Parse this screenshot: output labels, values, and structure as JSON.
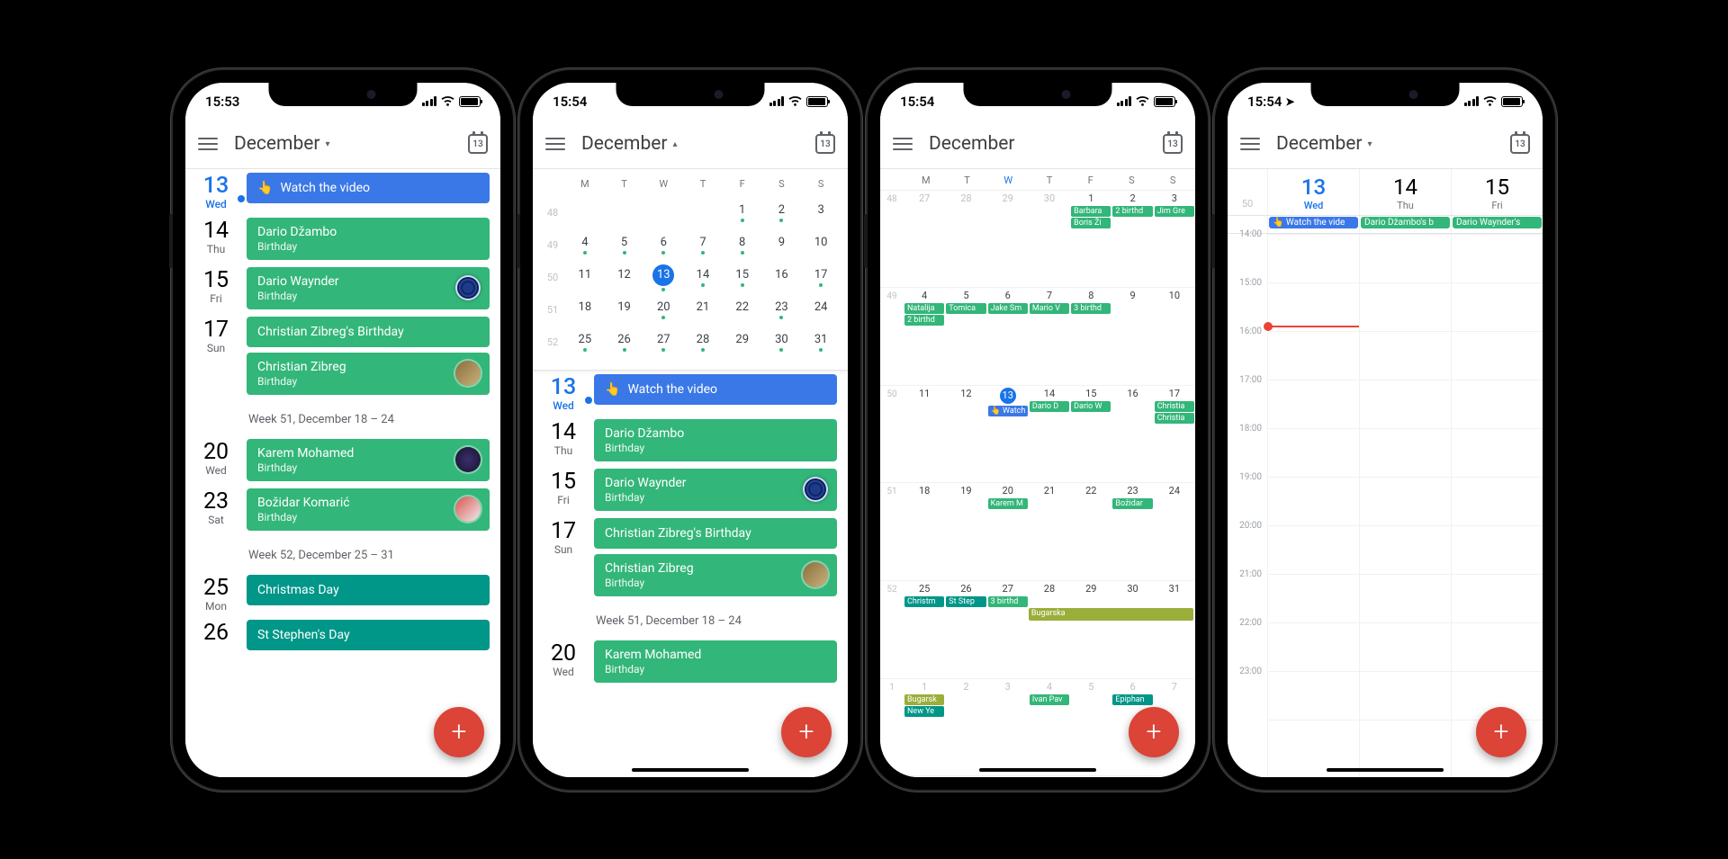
{
  "colors": {
    "blue": "#3b78e7",
    "green": "#33b679",
    "teal": "#009688",
    "olive": "#9aae3a",
    "red": "#db4437"
  },
  "common": {
    "month": "December",
    "today_date": "13",
    "watch_video": "Watch the video",
    "birthday_label": "Birthday"
  },
  "phone1": {
    "time": "15:53",
    "caret": "▾",
    "days": [
      {
        "date": "13",
        "dow": "Wed",
        "today": true,
        "events": [
          {
            "title": "Watch the video",
            "color": "blue",
            "icon": "👆"
          }
        ]
      },
      {
        "date": "14",
        "dow": "Thu",
        "events": [
          {
            "title": "Dario Džambo",
            "sub": "Birthday",
            "color": "green"
          }
        ]
      },
      {
        "date": "15",
        "dow": "Fri",
        "events": [
          {
            "title": "Dario Waynder",
            "sub": "Birthday",
            "color": "green",
            "avatar": "ring"
          }
        ]
      },
      {
        "date": "17",
        "dow": "Sun",
        "events": [
          {
            "title": "Christian Zibreg's Birthday",
            "color": "green"
          },
          {
            "title": "Christian Zibreg",
            "sub": "Birthday",
            "color": "green",
            "avatar": "p1"
          }
        ]
      }
    ],
    "week51_label": "Week 51, December 18 – 24",
    "days2": [
      {
        "date": "20",
        "dow": "Wed",
        "events": [
          {
            "title": "Karem Mohamed",
            "sub": "Birthday",
            "color": "green",
            "avatar": "p2"
          }
        ]
      },
      {
        "date": "23",
        "dow": "Sat",
        "events": [
          {
            "title": "Božidar Komarić",
            "sub": "Birthday",
            "color": "green",
            "avatar": "p3"
          }
        ]
      }
    ],
    "week52_label": "Week 52, December 25 – 31",
    "days3": [
      {
        "date": "25",
        "dow": "Mon",
        "events": [
          {
            "title": "Christmas Day",
            "color": "teal"
          }
        ]
      },
      {
        "date": "26",
        "dow": "",
        "events": [
          {
            "title": "St Stephen's Day",
            "color": "teal"
          }
        ]
      }
    ]
  },
  "phone2": {
    "time": "15:54",
    "caret": "▴",
    "dow_labels": [
      "M",
      "T",
      "W",
      "T",
      "F",
      "S",
      "S"
    ],
    "weeks": [
      {
        "wk": "48",
        "days": [
          {
            "n": ""
          },
          {
            "n": ""
          },
          {
            "n": ""
          },
          {
            "n": ""
          },
          {
            "n": "1",
            "dot": true
          },
          {
            "n": "2",
            "dot": true
          },
          {
            "n": "3"
          }
        ]
      },
      {
        "wk": "49",
        "days": [
          {
            "n": "4",
            "dot": true
          },
          {
            "n": "5",
            "dot": true
          },
          {
            "n": "6",
            "dot": true
          },
          {
            "n": "7",
            "dot": true
          },
          {
            "n": "8",
            "dot": true
          },
          {
            "n": "9"
          },
          {
            "n": "10"
          }
        ]
      },
      {
        "wk": "50",
        "days": [
          {
            "n": "11"
          },
          {
            "n": "12"
          },
          {
            "n": "13",
            "today": true,
            "dot": true
          },
          {
            "n": "14",
            "dot": true
          },
          {
            "n": "15",
            "dot": true
          },
          {
            "n": "16"
          },
          {
            "n": "17",
            "dot": true
          }
        ]
      },
      {
        "wk": "51",
        "days": [
          {
            "n": "18"
          },
          {
            "n": "19"
          },
          {
            "n": "20",
            "dot": true
          },
          {
            "n": "21"
          },
          {
            "n": "22"
          },
          {
            "n": "23",
            "dot": true
          },
          {
            "n": "24"
          }
        ]
      },
      {
        "wk": "52",
        "days": [
          {
            "n": "25",
            "dot": true
          },
          {
            "n": "26",
            "dot": true
          },
          {
            "n": "27",
            "dot": true
          },
          {
            "n": "28",
            "dot": true
          },
          {
            "n": "29"
          },
          {
            "n": "30",
            "dot": true
          },
          {
            "n": "31",
            "dot": true
          }
        ]
      }
    ],
    "days": [
      {
        "date": "13",
        "dow": "Wed",
        "today": true,
        "events": [
          {
            "title": "Watch the video",
            "color": "blue",
            "icon": "👆"
          }
        ]
      },
      {
        "date": "14",
        "dow": "Thu",
        "events": [
          {
            "title": "Dario Džambo",
            "sub": "Birthday",
            "color": "green"
          }
        ]
      },
      {
        "date": "15",
        "dow": "Fri",
        "events": [
          {
            "title": "Dario Waynder",
            "sub": "Birthday",
            "color": "green",
            "avatar": "ring"
          }
        ]
      },
      {
        "date": "17",
        "dow": "Sun",
        "events": [
          {
            "title": "Christian Zibreg's Birthday",
            "color": "green"
          },
          {
            "title": "Christian Zibreg",
            "sub": "Birthday",
            "color": "green",
            "avatar": "p1"
          }
        ]
      }
    ],
    "week51_label": "Week 51, December 18 – 24",
    "days2": [
      {
        "date": "20",
        "dow": "Wed",
        "events": [
          {
            "title": "Karem Mohamed",
            "sub": "Birthday",
            "color": "green"
          }
        ]
      }
    ]
  },
  "phone3": {
    "time": "15:54",
    "dow_labels": [
      "M",
      "T",
      "W",
      "T",
      "F",
      "S",
      "S"
    ],
    "rows": [
      {
        "wk": "48",
        "cells": [
          {
            "n": "27",
            "out": true,
            "chips": []
          },
          {
            "n": "28",
            "out": true,
            "chips": []
          },
          {
            "n": "29",
            "out": true,
            "chips": []
          },
          {
            "n": "30",
            "out": true,
            "chips": []
          },
          {
            "n": "1",
            "chips": [
              {
                "t": "Barbara",
                "c": "green"
              },
              {
                "t": "Boris Ži",
                "c": "green"
              }
            ]
          },
          {
            "n": "2",
            "chips": [
              {
                "t": "2 birthd",
                "c": "green"
              }
            ]
          },
          {
            "n": "3",
            "chips": [
              {
                "t": "Jim Gre",
                "c": "green"
              }
            ]
          }
        ]
      },
      {
        "wk": "49",
        "cells": [
          {
            "n": "4",
            "chips": [
              {
                "t": "Natalija",
                "c": "green"
              },
              {
                "t": "2 birthd",
                "c": "green"
              }
            ]
          },
          {
            "n": "5",
            "chips": [
              {
                "t": "Tomica",
                "c": "green"
              }
            ]
          },
          {
            "n": "6",
            "chips": [
              {
                "t": "Jake Sm",
                "c": "green"
              }
            ]
          },
          {
            "n": "7",
            "chips": [
              {
                "t": "Mario V",
                "c": "green"
              }
            ]
          },
          {
            "n": "8",
            "chips": [
              {
                "t": "3 birthd",
                "c": "green"
              }
            ]
          },
          {
            "n": "9",
            "chips": []
          },
          {
            "n": "10",
            "chips": []
          }
        ]
      },
      {
        "wk": "50",
        "cells": [
          {
            "n": "11",
            "chips": []
          },
          {
            "n": "12",
            "chips": []
          },
          {
            "n": "13",
            "today": true,
            "chips": [
              {
                "t": "👆 Watch",
                "c": "blue"
              }
            ]
          },
          {
            "n": "14",
            "chips": [
              {
                "t": "Dario D",
                "c": "green"
              }
            ]
          },
          {
            "n": "15",
            "chips": [
              {
                "t": "Dario W",
                "c": "green"
              }
            ]
          },
          {
            "n": "16",
            "chips": []
          },
          {
            "n": "17",
            "chips": [
              {
                "t": "Christia",
                "c": "green"
              },
              {
                "t": "Christia",
                "c": "green"
              }
            ]
          }
        ]
      },
      {
        "wk": "51",
        "cells": [
          {
            "n": "18",
            "chips": []
          },
          {
            "n": "19",
            "chips": []
          },
          {
            "n": "20",
            "chips": [
              {
                "t": "Karem M",
                "c": "green"
              }
            ]
          },
          {
            "n": "21",
            "chips": []
          },
          {
            "n": "22",
            "chips": []
          },
          {
            "n": "23",
            "chips": [
              {
                "t": "Božidar",
                "c": "green"
              }
            ]
          },
          {
            "n": "24",
            "chips": []
          }
        ]
      },
      {
        "wk": "52",
        "cells": [
          {
            "n": "25",
            "chips": [
              {
                "t": "Christm",
                "c": "teal"
              }
            ]
          },
          {
            "n": "26",
            "chips": [
              {
                "t": "St Step",
                "c": "teal"
              }
            ]
          },
          {
            "n": "27",
            "chips": [
              {
                "t": "3 birthd",
                "c": "green"
              }
            ]
          },
          {
            "n": "28",
            "chips": []
          },
          {
            "n": "29",
            "chips": []
          },
          {
            "n": "30",
            "chips": []
          },
          {
            "n": "31",
            "chips": []
          }
        ],
        "span": {
          "t": "Bugarska",
          "c": "olive",
          "from": 4,
          "to": 7
        }
      },
      {
        "wk": "1",
        "cells": [
          {
            "n": "1",
            "out": true,
            "chips": [
              {
                "t": "Bugarsk",
                "c": "olive"
              },
              {
                "t": "New Ye",
                "c": "teal"
              }
            ]
          },
          {
            "n": "2",
            "out": true,
            "chips": []
          },
          {
            "n": "3",
            "out": true,
            "chips": []
          },
          {
            "n": "4",
            "out": true,
            "chips": [
              {
                "t": "Ivan Pav",
                "c": "green"
              }
            ]
          },
          {
            "n": "5",
            "out": true,
            "chips": []
          },
          {
            "n": "6",
            "out": true,
            "chips": [
              {
                "t": "Epiphan",
                "c": "teal"
              }
            ]
          },
          {
            "n": "7",
            "out": true,
            "chips": []
          }
        ]
      }
    ]
  },
  "phone4": {
    "time": "15:54",
    "wk": "50",
    "days": [
      {
        "n": "13",
        "dow": "Wed",
        "today": true,
        "allday": {
          "t": "👆 Watch the vide",
          "c": "blue"
        }
      },
      {
        "n": "14",
        "dow": "Thu",
        "allday": {
          "t": "Dario Džambo's b",
          "c": "green"
        }
      },
      {
        "n": "15",
        "dow": "Fri",
        "allday": {
          "t": "Dario Waynder's",
          "c": "green"
        }
      }
    ],
    "hours": [
      "14:00",
      "15:00",
      "16:00",
      "17:00",
      "18:00",
      "19:00",
      "20:00",
      "21:00",
      "22:00",
      "23:00"
    ],
    "now_hour_offset": 1.9
  }
}
